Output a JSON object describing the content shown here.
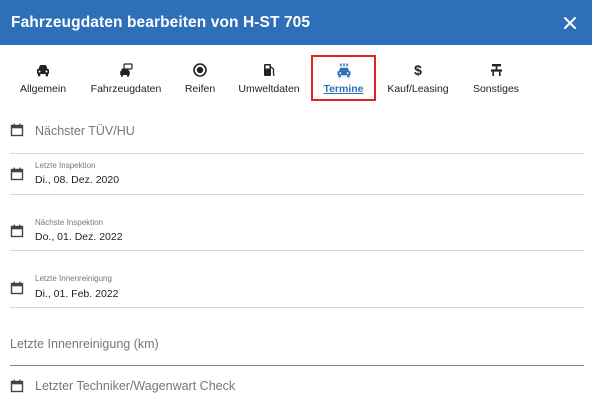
{
  "dialog": {
    "title": "Fahrzeugdaten bearbeiten von H-ST 705",
    "close_icon": "close-icon"
  },
  "tabs": [
    {
      "label": "Allgemein",
      "icon": "car-icon",
      "active": false
    },
    {
      "label": "Fahrzeugdaten",
      "icon": "car-multiple-icon",
      "active": false
    },
    {
      "label": "Reifen",
      "icon": "tire-icon",
      "active": false
    },
    {
      "label": "Umweltdaten",
      "icon": "fuel-pump-icon",
      "active": false
    },
    {
      "label": "Termine",
      "icon": "car-inspection-icon",
      "active": true
    },
    {
      "label": "Kauf/Leasing",
      "icon": "dollar-icon",
      "active": false
    },
    {
      "label": "Sonstiges",
      "icon": "tools-icon",
      "active": false
    }
  ],
  "fields": {
    "tuev": {
      "placeholder": "Nächster TÜV/HU"
    },
    "letzte_inspektion": {
      "label": "Letzte Inspektion",
      "value": "Di., 08. Dez. 2020"
    },
    "naechste_inspektion": {
      "label": "Nächste Inspektion",
      "value": "Do., 01. Dez. 2022"
    },
    "letzte_innenreinigung": {
      "label": "Letzte Innenreinigung",
      "value": "Di., 01. Feb. 2022"
    },
    "innenreinigung_km": {
      "placeholder": "Letzte Innenreinigung (km)"
    },
    "techniker_check": {
      "placeholder": "Letzter Techniker/Wagenwart Check"
    }
  },
  "colors": {
    "header": "#2d6fb8",
    "active_tab": "#2d6fb8",
    "highlight_border": "#e52020"
  }
}
